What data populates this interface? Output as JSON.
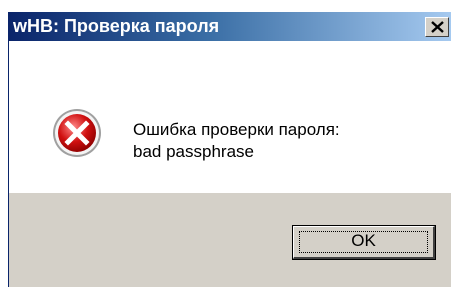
{
  "window": {
    "title": "wHB: Проверка пароля",
    "close_icon": "close-icon"
  },
  "message": {
    "icon": "error-icon",
    "line1": "Ошибка проверки пароля:",
    "line2": "bad passphrase"
  },
  "buttons": {
    "ok_label": "OK"
  },
  "colors": {
    "titlebar_start": "#0a246a",
    "titlebar_end": "#a6caf0",
    "dialog_face": "#d4d0c8",
    "error_red": "#d01010"
  }
}
